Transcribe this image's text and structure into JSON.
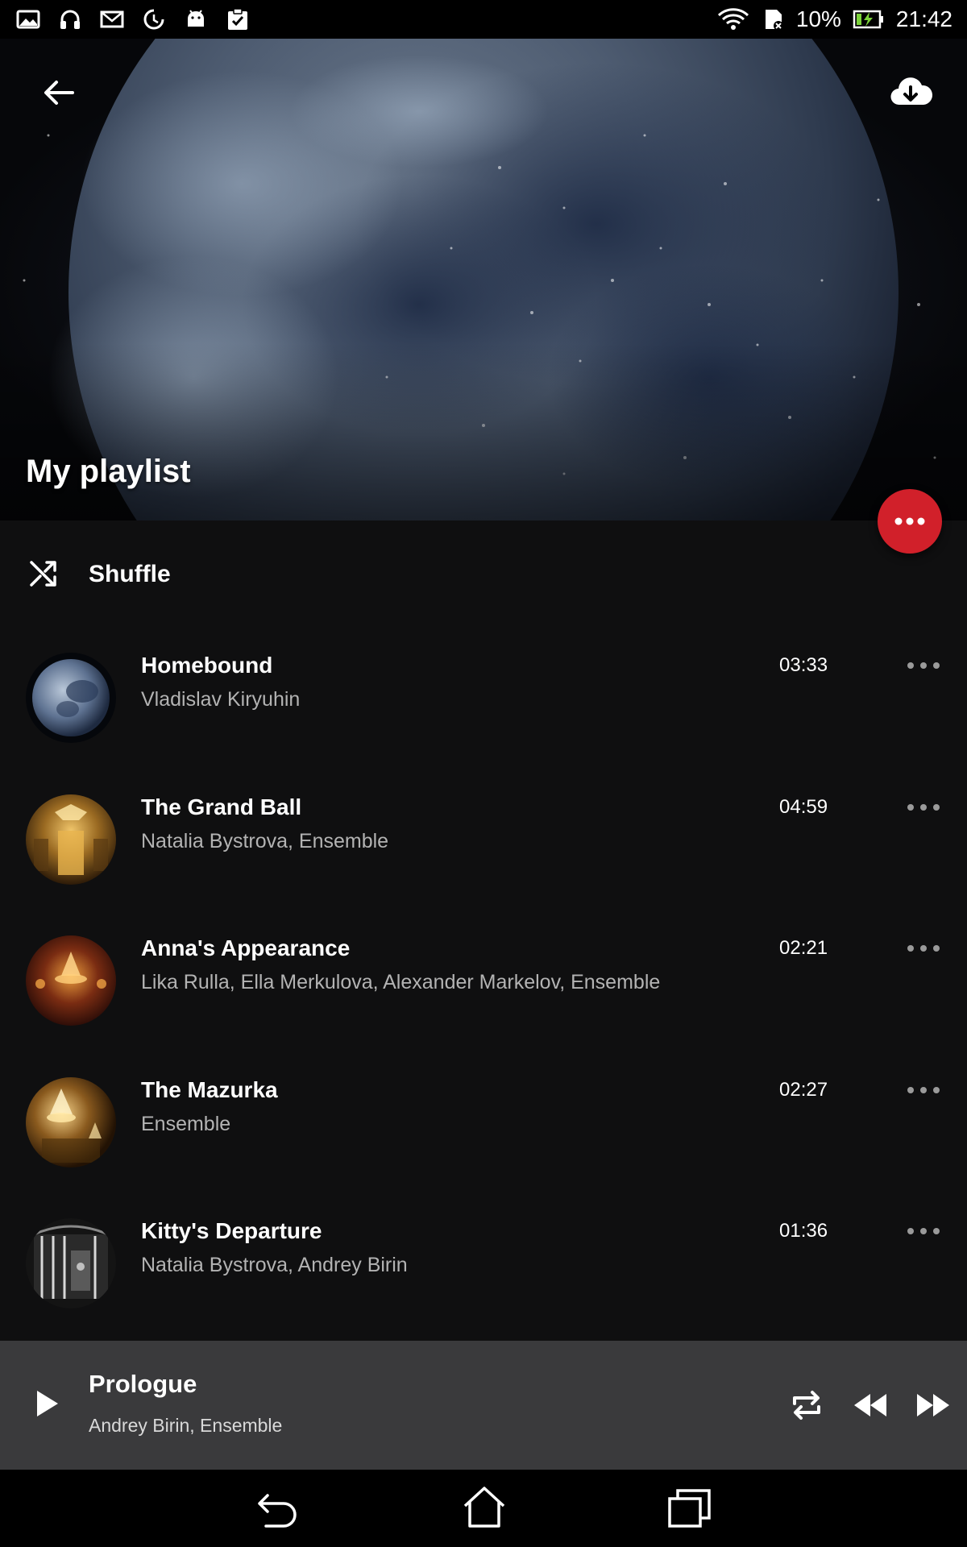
{
  "status_bar": {
    "battery_percent": "10%",
    "time": "21:42",
    "left_icons": [
      "image-icon",
      "headphones-icon",
      "mail-icon",
      "data-saver-icon",
      "android-icon",
      "clipboard-check-icon"
    ],
    "right_icons": [
      "wifi-icon",
      "sd-card-icon",
      "battery-charging-icon"
    ]
  },
  "header": {
    "title": "My playlist",
    "back_icon": "arrow-left-icon",
    "download_icon": "cloud-download-icon"
  },
  "fab": {
    "icon": "more-horizontal-icon",
    "color": "#d1202a"
  },
  "shuffle": {
    "label": "Shuffle",
    "icon": "shuffle-icon"
  },
  "tracks": [
    {
      "title": "Homebound",
      "artist": "Vladislav Kiryuhin",
      "duration": "03:33",
      "thumb": "moon"
    },
    {
      "title": "The Grand Ball",
      "artist": "Natalia Bystrova, Ensemble",
      "duration": "04:59",
      "thumb": "ballroom"
    },
    {
      "title": "Anna's Appearance",
      "artist": "Lika Rulla, Ella Merkulova, Alexander Markelov, Ensemble",
      "duration": "02:21",
      "thumb": "chandelier-red"
    },
    {
      "title": "The Mazurka",
      "artist": "Ensemble",
      "duration": "02:27",
      "thumb": "chandelier-gold"
    },
    {
      "title": "Kitty's Departure",
      "artist": "Natalia Bystrova, Andrey Birin",
      "duration": "01:36",
      "thumb": "train"
    }
  ],
  "now_playing": {
    "title": "Prologue",
    "artist": "Andrey Birin, Ensemble",
    "controls": [
      "play-icon",
      "repeat-icon",
      "rewind-icon",
      "fast-forward-icon"
    ]
  },
  "nav_bar": {
    "icons": [
      "nav-back-icon",
      "nav-home-icon",
      "nav-recent-apps-icon"
    ]
  },
  "colors": {
    "background": "#0f0f10",
    "accent": "#d1202a",
    "mini_player": "#3a3a3c",
    "secondary_text": "#b3b3b3"
  }
}
